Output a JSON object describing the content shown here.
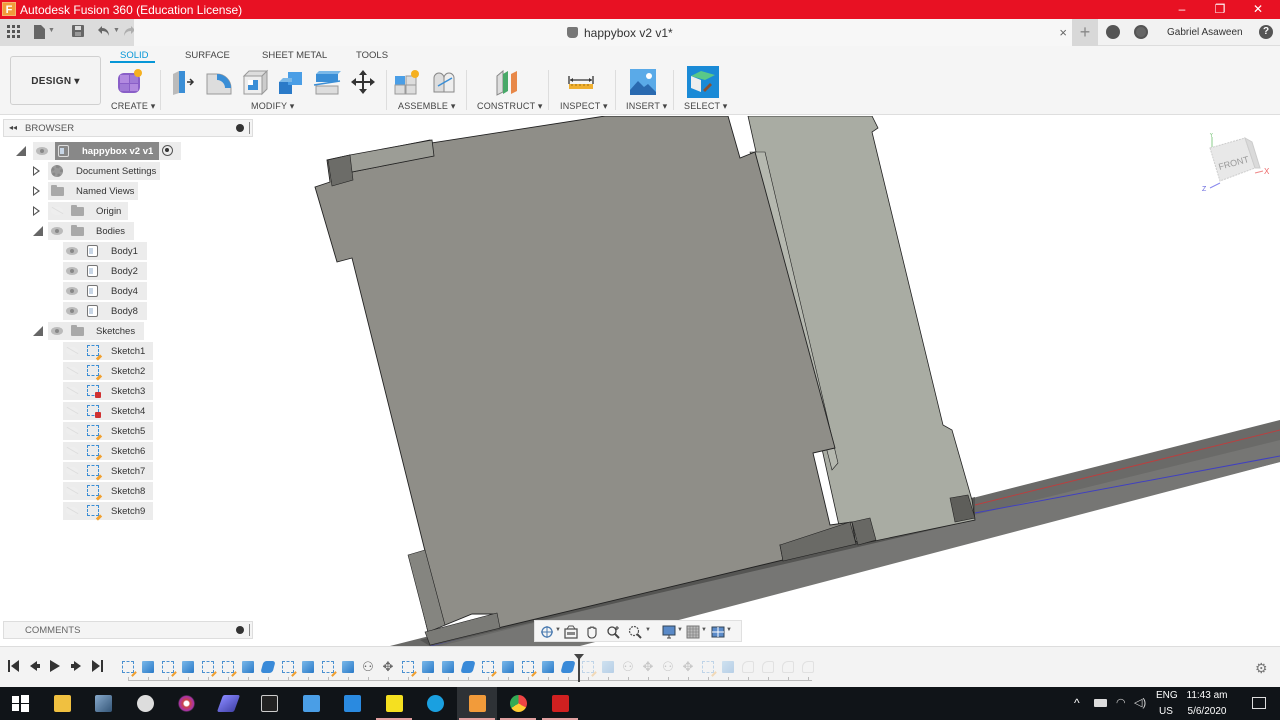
{
  "window": {
    "title": "Autodesk Fusion 360 (Education License)",
    "app_icon_letter": "F",
    "controls": {
      "minimize": "–",
      "maximize": "❐",
      "close": "✕"
    }
  },
  "tabbar": {
    "document_title": "happybox v2 v1*",
    "close_glyph": "×",
    "new_tab_glyph": "+",
    "user_name": "Gabriel Asaween",
    "help_glyph": "?"
  },
  "toolbar": {
    "workspace_button": "DESIGN ▾",
    "workspace_tabs": [
      {
        "label": "SOLID",
        "active": true
      },
      {
        "label": "SURFACE",
        "active": false
      },
      {
        "label": "SHEET METAL",
        "active": false
      },
      {
        "label": "TOOLS",
        "active": false
      }
    ],
    "groups": [
      {
        "label": "CREATE ▾"
      },
      {
        "label": "MODIFY ▾"
      },
      {
        "label": "ASSEMBLE ▾"
      },
      {
        "label": "CONSTRUCT ▾"
      },
      {
        "label": "INSPECT ▾"
      },
      {
        "label": "INSERT ▾"
      },
      {
        "label": "SELECT ▾"
      }
    ]
  },
  "browser": {
    "title": "BROWSER",
    "collapse_glyph": "◂◂",
    "root": {
      "label": "happybox v2 v1"
    },
    "items": [
      {
        "label": "Document Settings"
      },
      {
        "label": "Named Views"
      },
      {
        "label": "Origin"
      },
      {
        "label": "Bodies"
      },
      {
        "label": "Sketches"
      }
    ],
    "bodies": [
      "Body1",
      "Body2",
      "Body4",
      "Body8"
    ],
    "sketches": [
      {
        "label": "Sketch1",
        "error": false
      },
      {
        "label": "Sketch2",
        "error": false
      },
      {
        "label": "Sketch3",
        "error": true
      },
      {
        "label": "Sketch4",
        "error": true
      },
      {
        "label": "Sketch5",
        "error": false
      },
      {
        "label": "Sketch6",
        "error": false
      },
      {
        "label": "Sketch7",
        "error": false
      },
      {
        "label": "Sketch8",
        "error": false
      },
      {
        "label": "Sketch9",
        "error": false
      }
    ]
  },
  "comments": {
    "title": "COMMENTS"
  },
  "viewcube": {
    "face_label": "FRONT",
    "axis_x": "X",
    "axis_y": "Y",
    "axis_z": "Z"
  },
  "timeline": {
    "controls": [
      "⏮",
      "◂",
      "▶",
      "▸",
      "⏭"
    ],
    "features": [
      "sketch",
      "extrude",
      "sketch",
      "extrude",
      "sketch",
      "sketch",
      "extrude",
      "combine",
      "sketch",
      "extrude",
      "sketch",
      "extrude",
      "joint",
      "move",
      "sketch",
      "extrude",
      "extrude",
      "combine",
      "sketch",
      "extrude",
      "sketch",
      "extrude",
      "combine",
      "sketch",
      "extrude",
      "joint",
      "move",
      "joint",
      "move",
      "sketch",
      "extrude",
      "fillet",
      "fillet",
      "fillet",
      "fillet"
    ],
    "marker_after_index": 22
  },
  "taskbar": {
    "apps": [
      "windows-start",
      "file-explorer",
      "notes",
      "remote-desktop",
      "media-player",
      "network-app",
      "terminal",
      "screen-search",
      "text-editor",
      "sticky-notes",
      "skype",
      "fusion-360",
      "chrome",
      "autocad"
    ],
    "tray": {
      "lang_top": "ENG",
      "lang_bottom": "US",
      "time": "11:43 am",
      "date": "5/6/2020"
    }
  },
  "colors": {
    "title_bar": "#e81123",
    "accent": "#0696d7",
    "body_face": "#8f8e88",
    "body_side": "#a9aca3",
    "base_plate": "#5a5a58"
  }
}
